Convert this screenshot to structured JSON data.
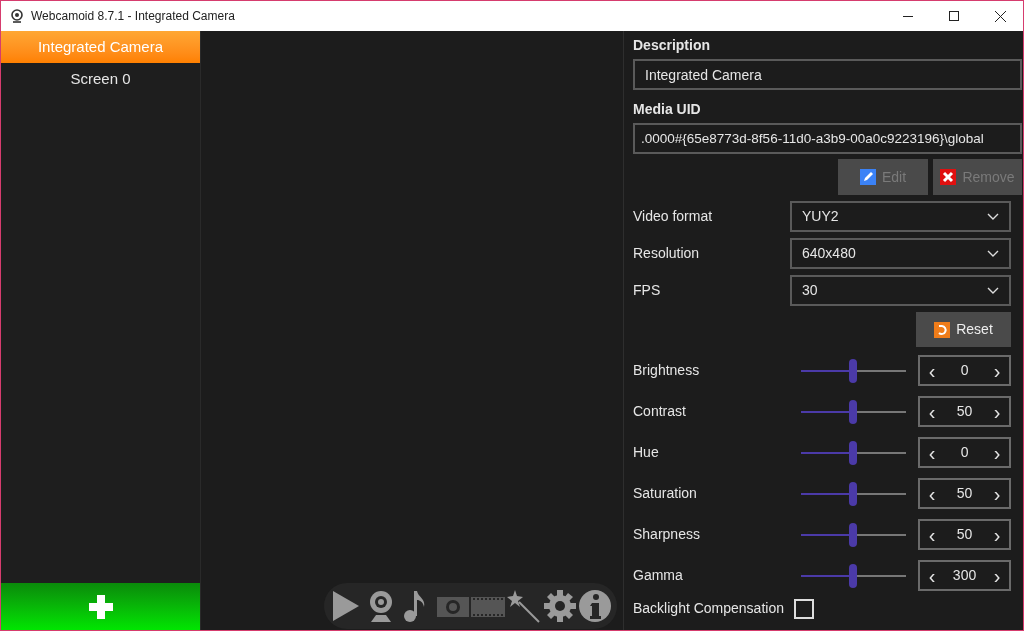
{
  "window": {
    "title": "Webcamoid 8.7.1 - Integrated Camera"
  },
  "sidebar": {
    "items": [
      {
        "label": "Integrated Camera",
        "selected": true
      },
      {
        "label": "Screen 0",
        "selected": false
      }
    ]
  },
  "description": {
    "label": "Description",
    "value": "Integrated Camera"
  },
  "media_uid": {
    "label": "Media UID",
    "value": ".0000#{65e8773d-8f56-11d0-a3b9-00a0c9223196}\\global"
  },
  "actions": [
    {
      "kind": "edit",
      "label": "Edit",
      "disabled": true
    },
    {
      "kind": "remove",
      "label": "Remove",
      "disabled": true
    }
  ],
  "formats": [
    {
      "label": "Video format",
      "value": "YUY2"
    },
    {
      "label": "Resolution",
      "value": "640x480"
    },
    {
      "label": "FPS",
      "value": "30"
    }
  ],
  "reset": {
    "label": "Reset"
  },
  "controls": [
    {
      "label": "Brightness",
      "level": 0.5,
      "value": "0",
      "prev": "‹",
      "next": "›"
    },
    {
      "label": "Contrast",
      "level": 0.5,
      "value": "50",
      "prev": "‹",
      "next": "›"
    },
    {
      "label": "Hue",
      "level": 0.5,
      "value": "0",
      "prev": "‹",
      "next": "›"
    },
    {
      "label": "Saturation",
      "level": 0.5,
      "value": "50",
      "prev": "‹",
      "next": "›"
    },
    {
      "label": "Sharpness",
      "level": 0.5,
      "value": "50",
      "prev": "‹",
      "next": "›"
    },
    {
      "label": "Gamma",
      "level": 0.5,
      "value": "300",
      "prev": "‹",
      "next": "›"
    }
  ],
  "backlight": {
    "label": "Backlight Compensation",
    "checked": false
  },
  "toolbar": [
    {
      "kind": "play",
      "disabled": false
    },
    {
      "kind": "webcam",
      "disabled": false
    },
    {
      "kind": "music",
      "disabled": false
    },
    {
      "kind": "camera",
      "disabled": true
    },
    {
      "kind": "film",
      "disabled": true
    },
    {
      "kind": "wand",
      "disabled": false
    },
    {
      "kind": "gear",
      "disabled": false
    },
    {
      "kind": "info",
      "disabled": false
    }
  ]
}
